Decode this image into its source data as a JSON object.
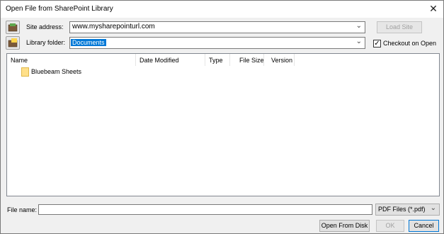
{
  "window": {
    "title": "Open File from SharePoint Library",
    "close_glyph": "✕"
  },
  "site": {
    "label": "Site address:",
    "value": "www.mysharepointurl.com",
    "icon": "site-icon",
    "load_button": "Load Site"
  },
  "library": {
    "label": "Library folder:",
    "value": "Documents",
    "icon": "library-folder-icon",
    "checkout_label": "Checkout on Open",
    "checkout_checked": true
  },
  "list": {
    "columns": [
      "Name",
      "Date Modified",
      "Type",
      "File Size",
      "Version"
    ],
    "items": [
      {
        "name": "Bluebeam Sheets",
        "icon": "folder-icon"
      }
    ]
  },
  "footer": {
    "file_name_label": "File name:",
    "file_name_value": "",
    "file_type_value": "PDF Files (*.pdf)",
    "open_from_disk": "Open From Disk",
    "ok": "OK",
    "cancel": "Cancel"
  }
}
